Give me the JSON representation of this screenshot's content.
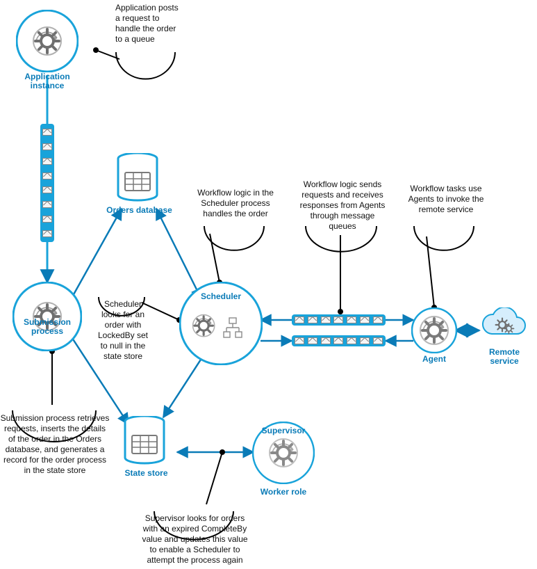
{
  "nodes": {
    "app_instance": {
      "label": "Application instance"
    },
    "submission": {
      "label": "Submission process"
    },
    "orders_db": {
      "label": "Orders database"
    },
    "scheduler": {
      "label": "Scheduler"
    },
    "state_store": {
      "label": "State store"
    },
    "supervisor": {
      "label": "Supervisor",
      "sublabel": "Worker role"
    },
    "agent": {
      "label": "Agent"
    },
    "remote_svc": {
      "label": "Remote service"
    }
  },
  "annotations": {
    "app_post": "Application posts a request to handle the order to a queue",
    "submission_ret": "Submission process retrieves requests, inserts the details of the order in the Orders database, and generates a record for the order process in the state store",
    "scheduler_looks": "Scheduler looks for an order with LockedBy set to null in the state store",
    "workflow_logic": "Workflow logic in the Scheduler process handles the order",
    "workflow_sends": "Workflow logic sends requests and receives responses from Agents through message queues",
    "workflow_tasks": "Workflow tasks use Agents to invoke the remote service",
    "supervisor_note": "Supervisor looks for orders with an expired CompleteBy value and updates this value to enable a Scheduler to attempt the process again"
  }
}
